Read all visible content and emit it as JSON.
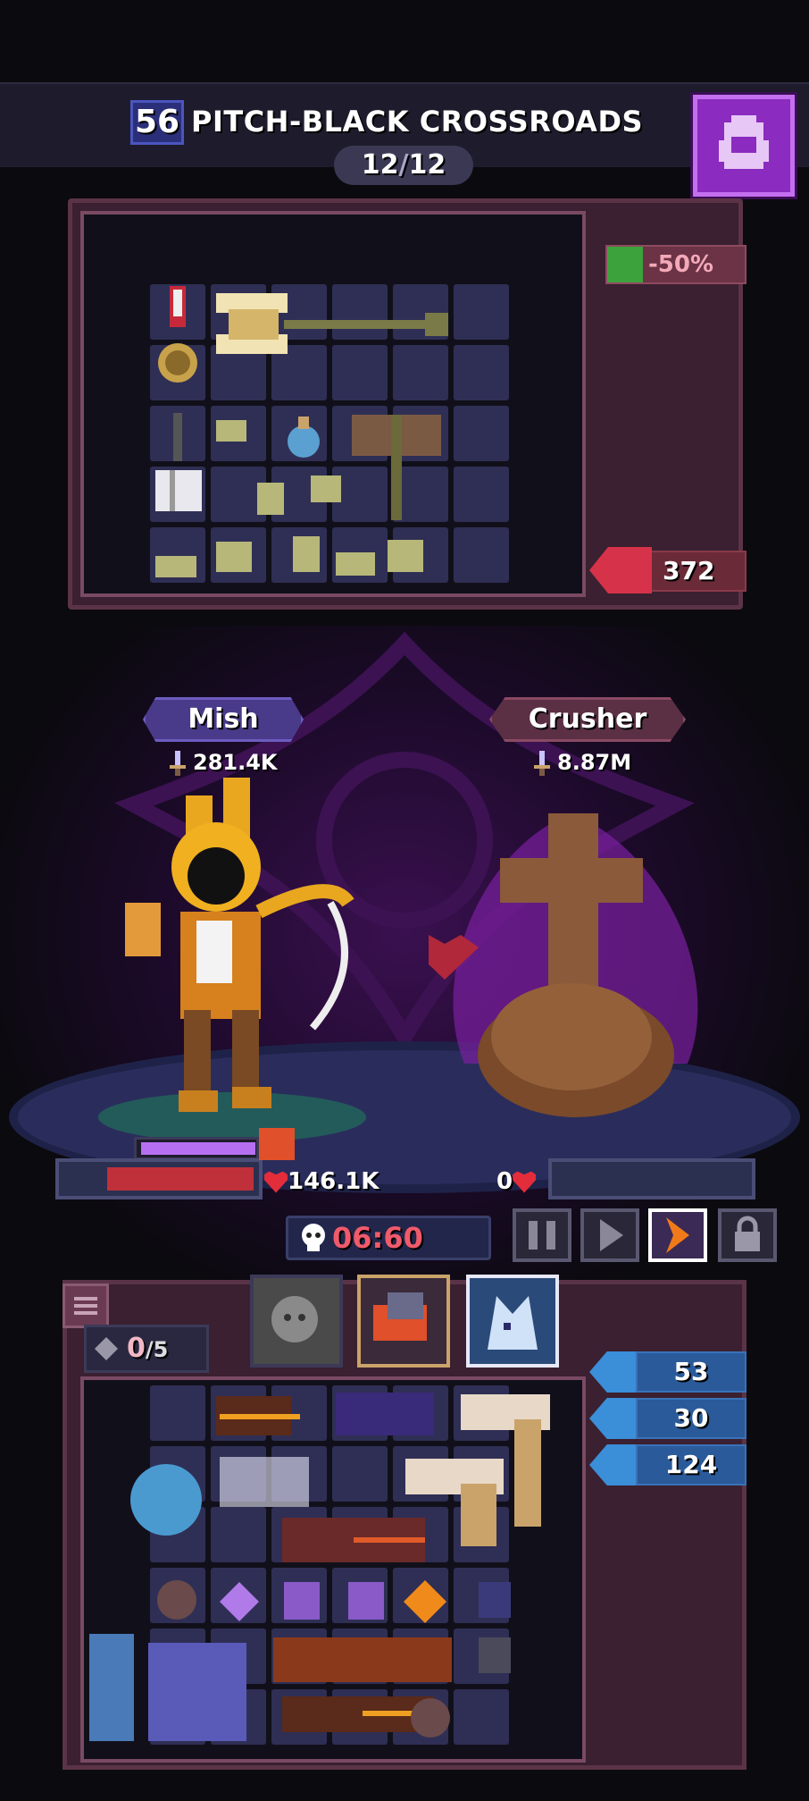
{
  "header": {
    "level": "56",
    "stage_title": "PITCH-BLACK CROSSROADS",
    "wave_current": "12",
    "wave_separator": "/",
    "wave_total": "12"
  },
  "enemy_inventory": {
    "debuff_value": "-50%",
    "gold_value": "372"
  },
  "battle": {
    "player": {
      "name": "Mish",
      "power": "281.4K",
      "hp": "146.1K"
    },
    "enemy": {
      "name": "Crusher",
      "power": "8.87M",
      "hp": "0"
    },
    "timer": "06:60"
  },
  "player_inventory": {
    "slots_used": "0",
    "slots_max": "/5",
    "stats": [
      "53",
      "30",
      "124"
    ]
  },
  "colors": {
    "accent_purple": "#8b2bbf",
    "hp_red": "#c0303a",
    "timer_red": "#f05a6b",
    "stat_blue": "#2a5a9a"
  },
  "icons": [
    "backpack-icon",
    "sword-icon",
    "heart-icon",
    "skull-icon",
    "pause-icon",
    "play-icon",
    "speed-icon",
    "lock-icon",
    "menu-icon",
    "gem-icon",
    "gold-icon",
    "debuff-icon"
  ]
}
